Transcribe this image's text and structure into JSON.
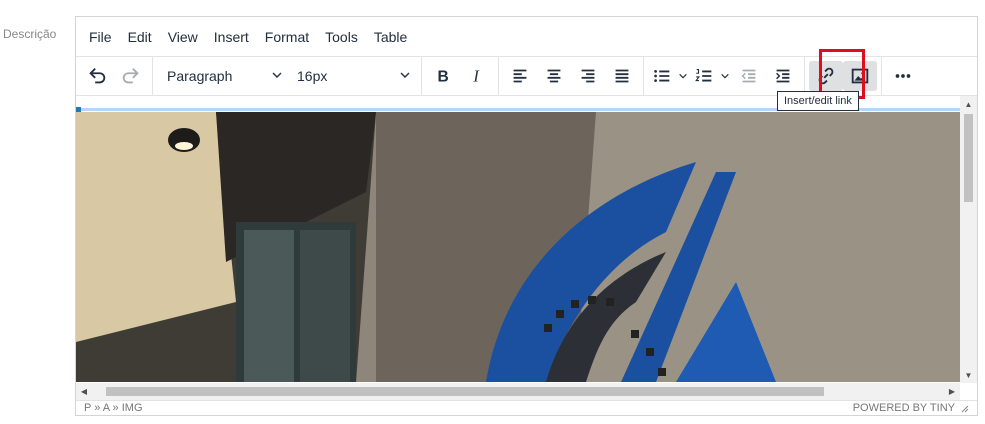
{
  "field": {
    "label": "Descrição"
  },
  "menubar": {
    "items": [
      "File",
      "Edit",
      "View",
      "Insert",
      "Format",
      "Tools",
      "Table"
    ]
  },
  "toolbar": {
    "block_format": "Paragraph",
    "font_size": "16px",
    "tooltip": "Insert/edit link"
  },
  "statusbar": {
    "path": "P » A » IMG",
    "branding": "POWERED BY TINY"
  },
  "colors": {
    "highlight": "#e00d1f",
    "text": "#222f3e",
    "selection": "#b4d7ff"
  }
}
